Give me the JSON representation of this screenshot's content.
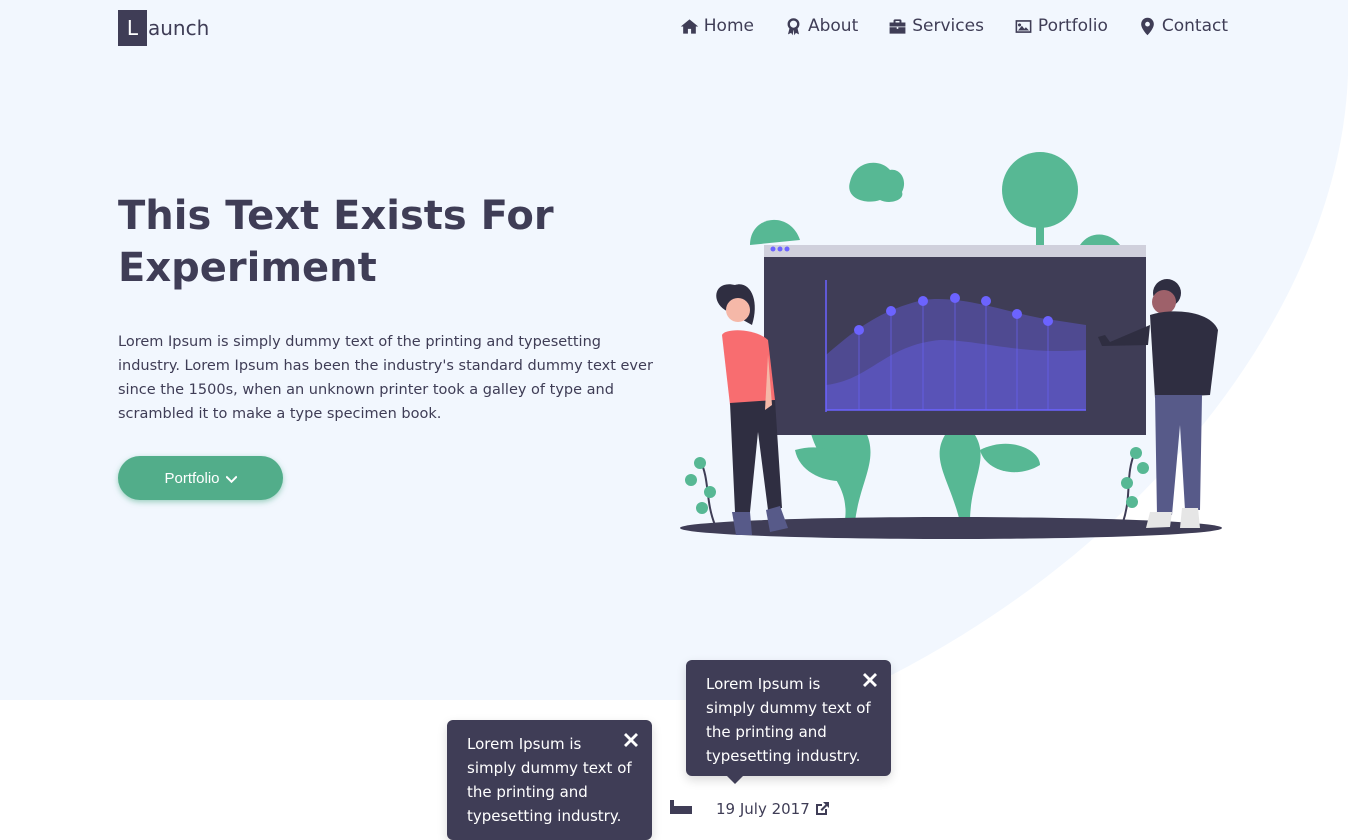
{
  "brand": {
    "letter": "L",
    "rest": "aunch"
  },
  "nav": [
    {
      "label": "Home",
      "icon": "home-icon"
    },
    {
      "label": "About",
      "icon": "award-icon"
    },
    {
      "label": "Services",
      "icon": "briefcase-icon"
    },
    {
      "label": "Portfolio",
      "icon": "image-icon"
    },
    {
      "label": "Contact",
      "icon": "map-marker-icon"
    }
  ],
  "hero": {
    "title_line1": "This Text Exists For",
    "title_line2": "Experiment",
    "text": "Lorem Ipsum is simply dummy text of the printing and typesetting industry. Lorem Ipsum has been the industry's standard dummy text ever since the 1500s, when an unknown printer took a galley of type and scrambled it to make a type specimen book.",
    "cta_label": "Portfolio"
  },
  "tooltips": [
    {
      "text": "Lorem Ipsum is simply dummy text of the printing and typesetting industry."
    },
    {
      "text": "Lorem Ipsum is simply dummy text of the printing and typesetting industry."
    }
  ],
  "timeline": {
    "date": "19 July 2017"
  },
  "colors": {
    "primary": "#3f3d56",
    "accent": "#52ad8a",
    "hero_bg": "#f2f7fe",
    "chart": "#6c63ff",
    "pink": "#f86d70"
  }
}
